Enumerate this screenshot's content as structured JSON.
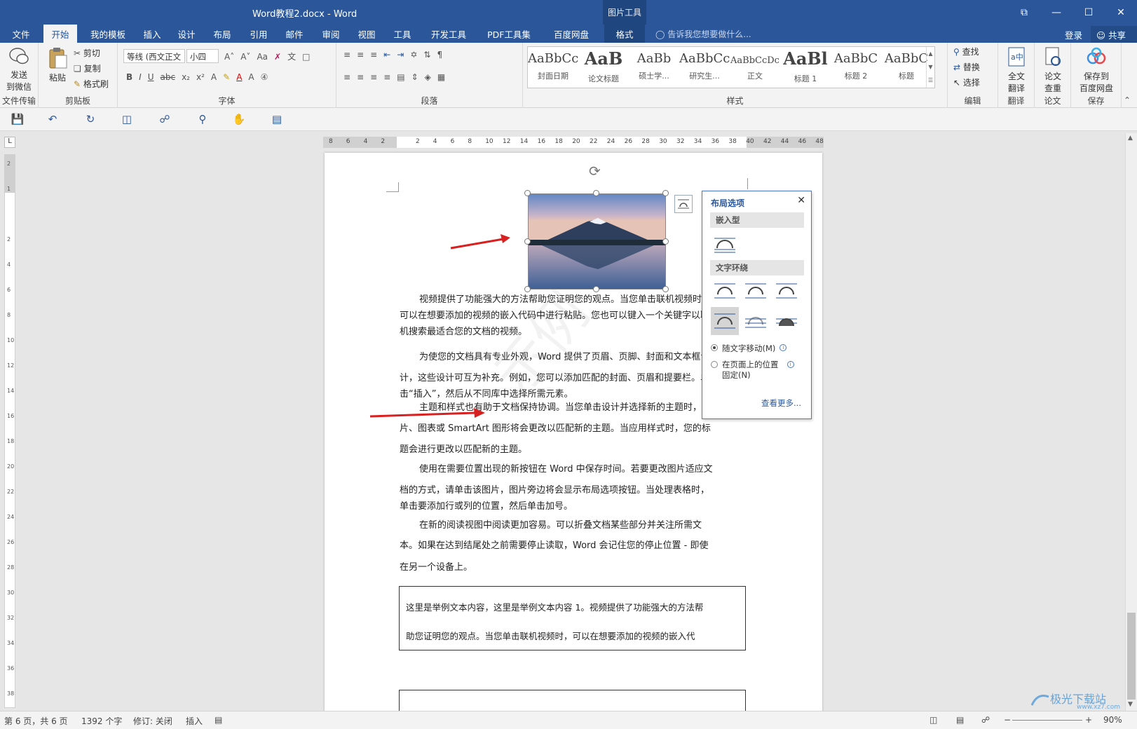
{
  "window": {
    "title": "Word教程2.docx - Word",
    "context_tool_group": "图片工具",
    "controls": {
      "restore_ribbon": "⧉",
      "minimize": "—",
      "maximize": "☐",
      "close": "✕"
    }
  },
  "tabs": [
    {
      "label": "文件",
      "state": "normal"
    },
    {
      "label": "开始",
      "state": "active"
    },
    {
      "label": "我的模板",
      "state": "normal"
    },
    {
      "label": "插入",
      "state": "normal"
    },
    {
      "label": "设计",
      "state": "normal"
    },
    {
      "label": "布局",
      "state": "normal"
    },
    {
      "label": "引用",
      "state": "normal"
    },
    {
      "label": "邮件",
      "state": "normal"
    },
    {
      "label": "审阅",
      "state": "normal"
    },
    {
      "label": "视图",
      "state": "normal"
    },
    {
      "label": "工具",
      "state": "normal"
    },
    {
      "label": "开发工具",
      "state": "normal"
    },
    {
      "label": "PDF工具集",
      "state": "normal"
    },
    {
      "label": "百度网盘",
      "state": "normal"
    },
    {
      "label": "格式",
      "state": "context"
    }
  ],
  "tell_me": {
    "placeholder": "告诉我您想要做什么..."
  },
  "account": {
    "login": "登录",
    "share": "共享"
  },
  "ribbon": {
    "send_wechat": {
      "line1": "发送",
      "line2": "到微信",
      "group": "文件传输"
    },
    "clipboard": {
      "paste": "粘贴",
      "cut": "剪切",
      "copy": "复制",
      "format_painter": "格式刷",
      "group": "剪贴板"
    },
    "font": {
      "family": "等线 (西文正文",
      "size": "小四",
      "group": "字体"
    },
    "paragraph": {
      "group": "段落"
    },
    "styles": {
      "group": "样式",
      "items": [
        {
          "sample": "AaBbCc",
          "name": "封面日期"
        },
        {
          "sample": "AaB",
          "name": "论文标题"
        },
        {
          "sample": "AaBb",
          "name": "硕士学..."
        },
        {
          "sample": "AaBbCc",
          "name": "研究生..."
        },
        {
          "sample": "AaBbCcDc",
          "name": "正文"
        },
        {
          "sample": "AaBl",
          "name": "标题 1"
        },
        {
          "sample": "AaBbC",
          "name": "标题 2"
        },
        {
          "sample": "AaBbC",
          "name": "标题"
        }
      ]
    },
    "editing": {
      "find": "查找",
      "replace": "替换",
      "select": "选择",
      "group": "编辑"
    },
    "translate": {
      "line1": "全文",
      "line2": "翻译",
      "group": "翻译"
    },
    "paper": {
      "line1": "论文",
      "line2": "查重",
      "group": "论文"
    },
    "save": {
      "line1": "保存到",
      "line2": "百度网盘",
      "group": "保存"
    }
  },
  "ruler": {
    "h_labels": [
      "8",
      "6",
      "4",
      "2",
      "",
      "2",
      "4",
      "6",
      "8",
      "10",
      "12",
      "14",
      "16",
      "18",
      "20",
      "22",
      "24",
      "26",
      "28",
      "30",
      "32",
      "34",
      "36",
      "38",
      "40",
      "42",
      "44",
      "46",
      "48"
    ],
    "v_labels": [
      "2",
      "1",
      "",
      "2",
      "4",
      "6",
      "8",
      "10",
      "12",
      "14",
      "16",
      "18",
      "20",
      "22",
      "24",
      "26",
      "28",
      "30",
      "32",
      "34",
      "36",
      "38"
    ]
  },
  "layout_options": {
    "title": "布局选项",
    "inline_section": "嵌入型",
    "wrap_section": "文字环绕",
    "move_with_text": "随文字移动(M)",
    "fix_position_line1": "在页面上的位置",
    "fix_position_line2": "固定(N)",
    "see_more": "查看更多...",
    "selected_option": "move_with_text"
  },
  "document": {
    "paragraphs": [
      [
        "视频提供了功能强大的方法帮助您证明您的观点。当您单击联机视频时，",
        "可以在想要添加的视频的嵌入代码中进行粘贴。您也可以键入一个关键字以联",
        "机搜索最适合您的文档的视频。"
      ],
      [
        "为使您的文档具有专业外观，Word 提供了页眉、页脚、封面和文本框设",
        "计，这些设计可互为补充。例如，您可以添加匹配的封面、页眉和提要栏。单",
        "击“插入”，然后从不同库中选择所需元素。"
      ],
      [
        "主题和样式也有助于文档保持协调。当您单击设计并选择新的主题时，图",
        "片、图表或 SmartArt 图形将会更改以匹配新的主题。当应用样式时，您的标",
        "题会进行更改以匹配新的主题。"
      ],
      [
        "使用在需要位置出现的新按钮在 Word 中保存时间。若要更改图片适应文",
        "档的方式，请单击该图片，图片旁边将会显示布局选项按钮。当处理表格时，",
        "单击要添加行或列的位置，然后单击加号。"
      ],
      [
        "在新的阅读视图中阅读更加容易。可以折叠文档某些部分并关注所需文",
        "本。如果在达到结尾处之前需要停止读取，Word 会记住您的停止位置 - 即使",
        "在另一个设备上。"
      ]
    ],
    "textbox": [
      "这里是举例文本内容，这里是举例文本内容 1。视频提供了功能强大的方法帮",
      "助您证明您的观点。当您单击联机视频时，可以在想要添加的视频的嵌入代"
    ],
    "watermark": "示例"
  },
  "status": {
    "page": "第 6 页，共 6 页",
    "words": "1392 个字",
    "track": "修订: 关闭",
    "mode": "插入",
    "zoom": "90%"
  },
  "brand": {
    "name": "极光下载站",
    "url": "www.xz7.com"
  },
  "colors": {
    "accent": "#2b579a",
    "arrow": "#d92020"
  }
}
